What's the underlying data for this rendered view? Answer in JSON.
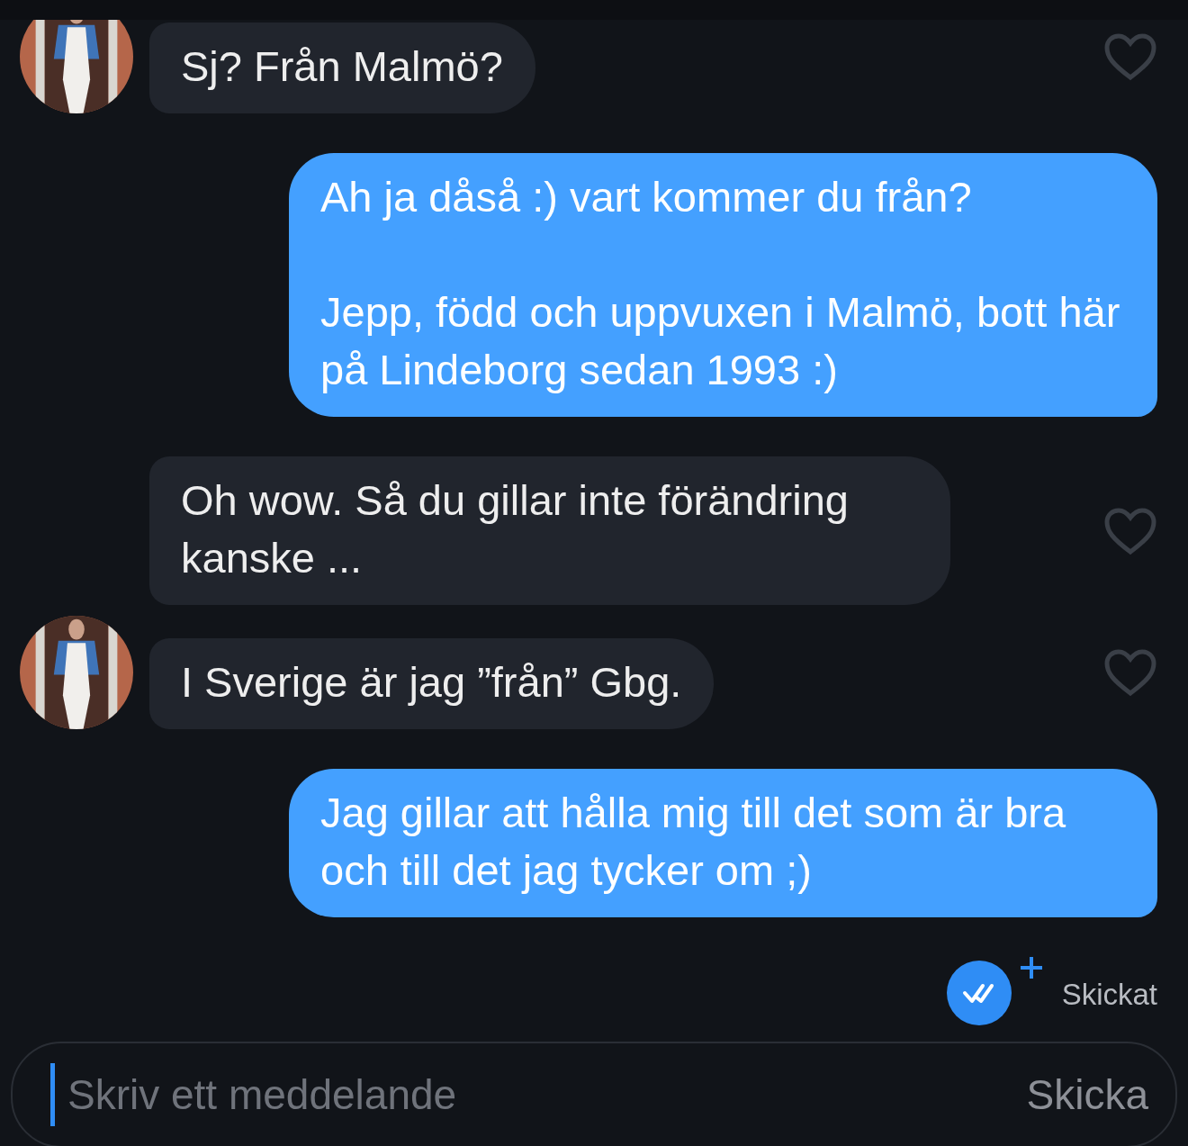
{
  "messages": [
    {
      "kind": "incoming",
      "text": "Sj? Från Malmö?",
      "avatar": true,
      "liked": false
    },
    {
      "kind": "outgoing",
      "text": "Ah ja dåså :) vart kommer du från?\n\nJepp, född och uppvuxen i Malmö, bott här på Lindeborg sedan 1993 :)"
    },
    {
      "kind": "incoming",
      "text": "Oh wow. Så du gillar inte förändring kanske ...",
      "avatar": false,
      "liked": false
    },
    {
      "kind": "incoming",
      "text": "I Sverige är jag ”från” Gbg.",
      "avatar": true,
      "liked": false
    },
    {
      "kind": "outgoing",
      "text": "Jag gillar att hålla mig till det som är bra och till det jag tycker om ;)"
    }
  ],
  "status": {
    "text": "Skickat"
  },
  "composer": {
    "placeholder": "Skriv ett meddelande",
    "send_label": "Skicka"
  }
}
